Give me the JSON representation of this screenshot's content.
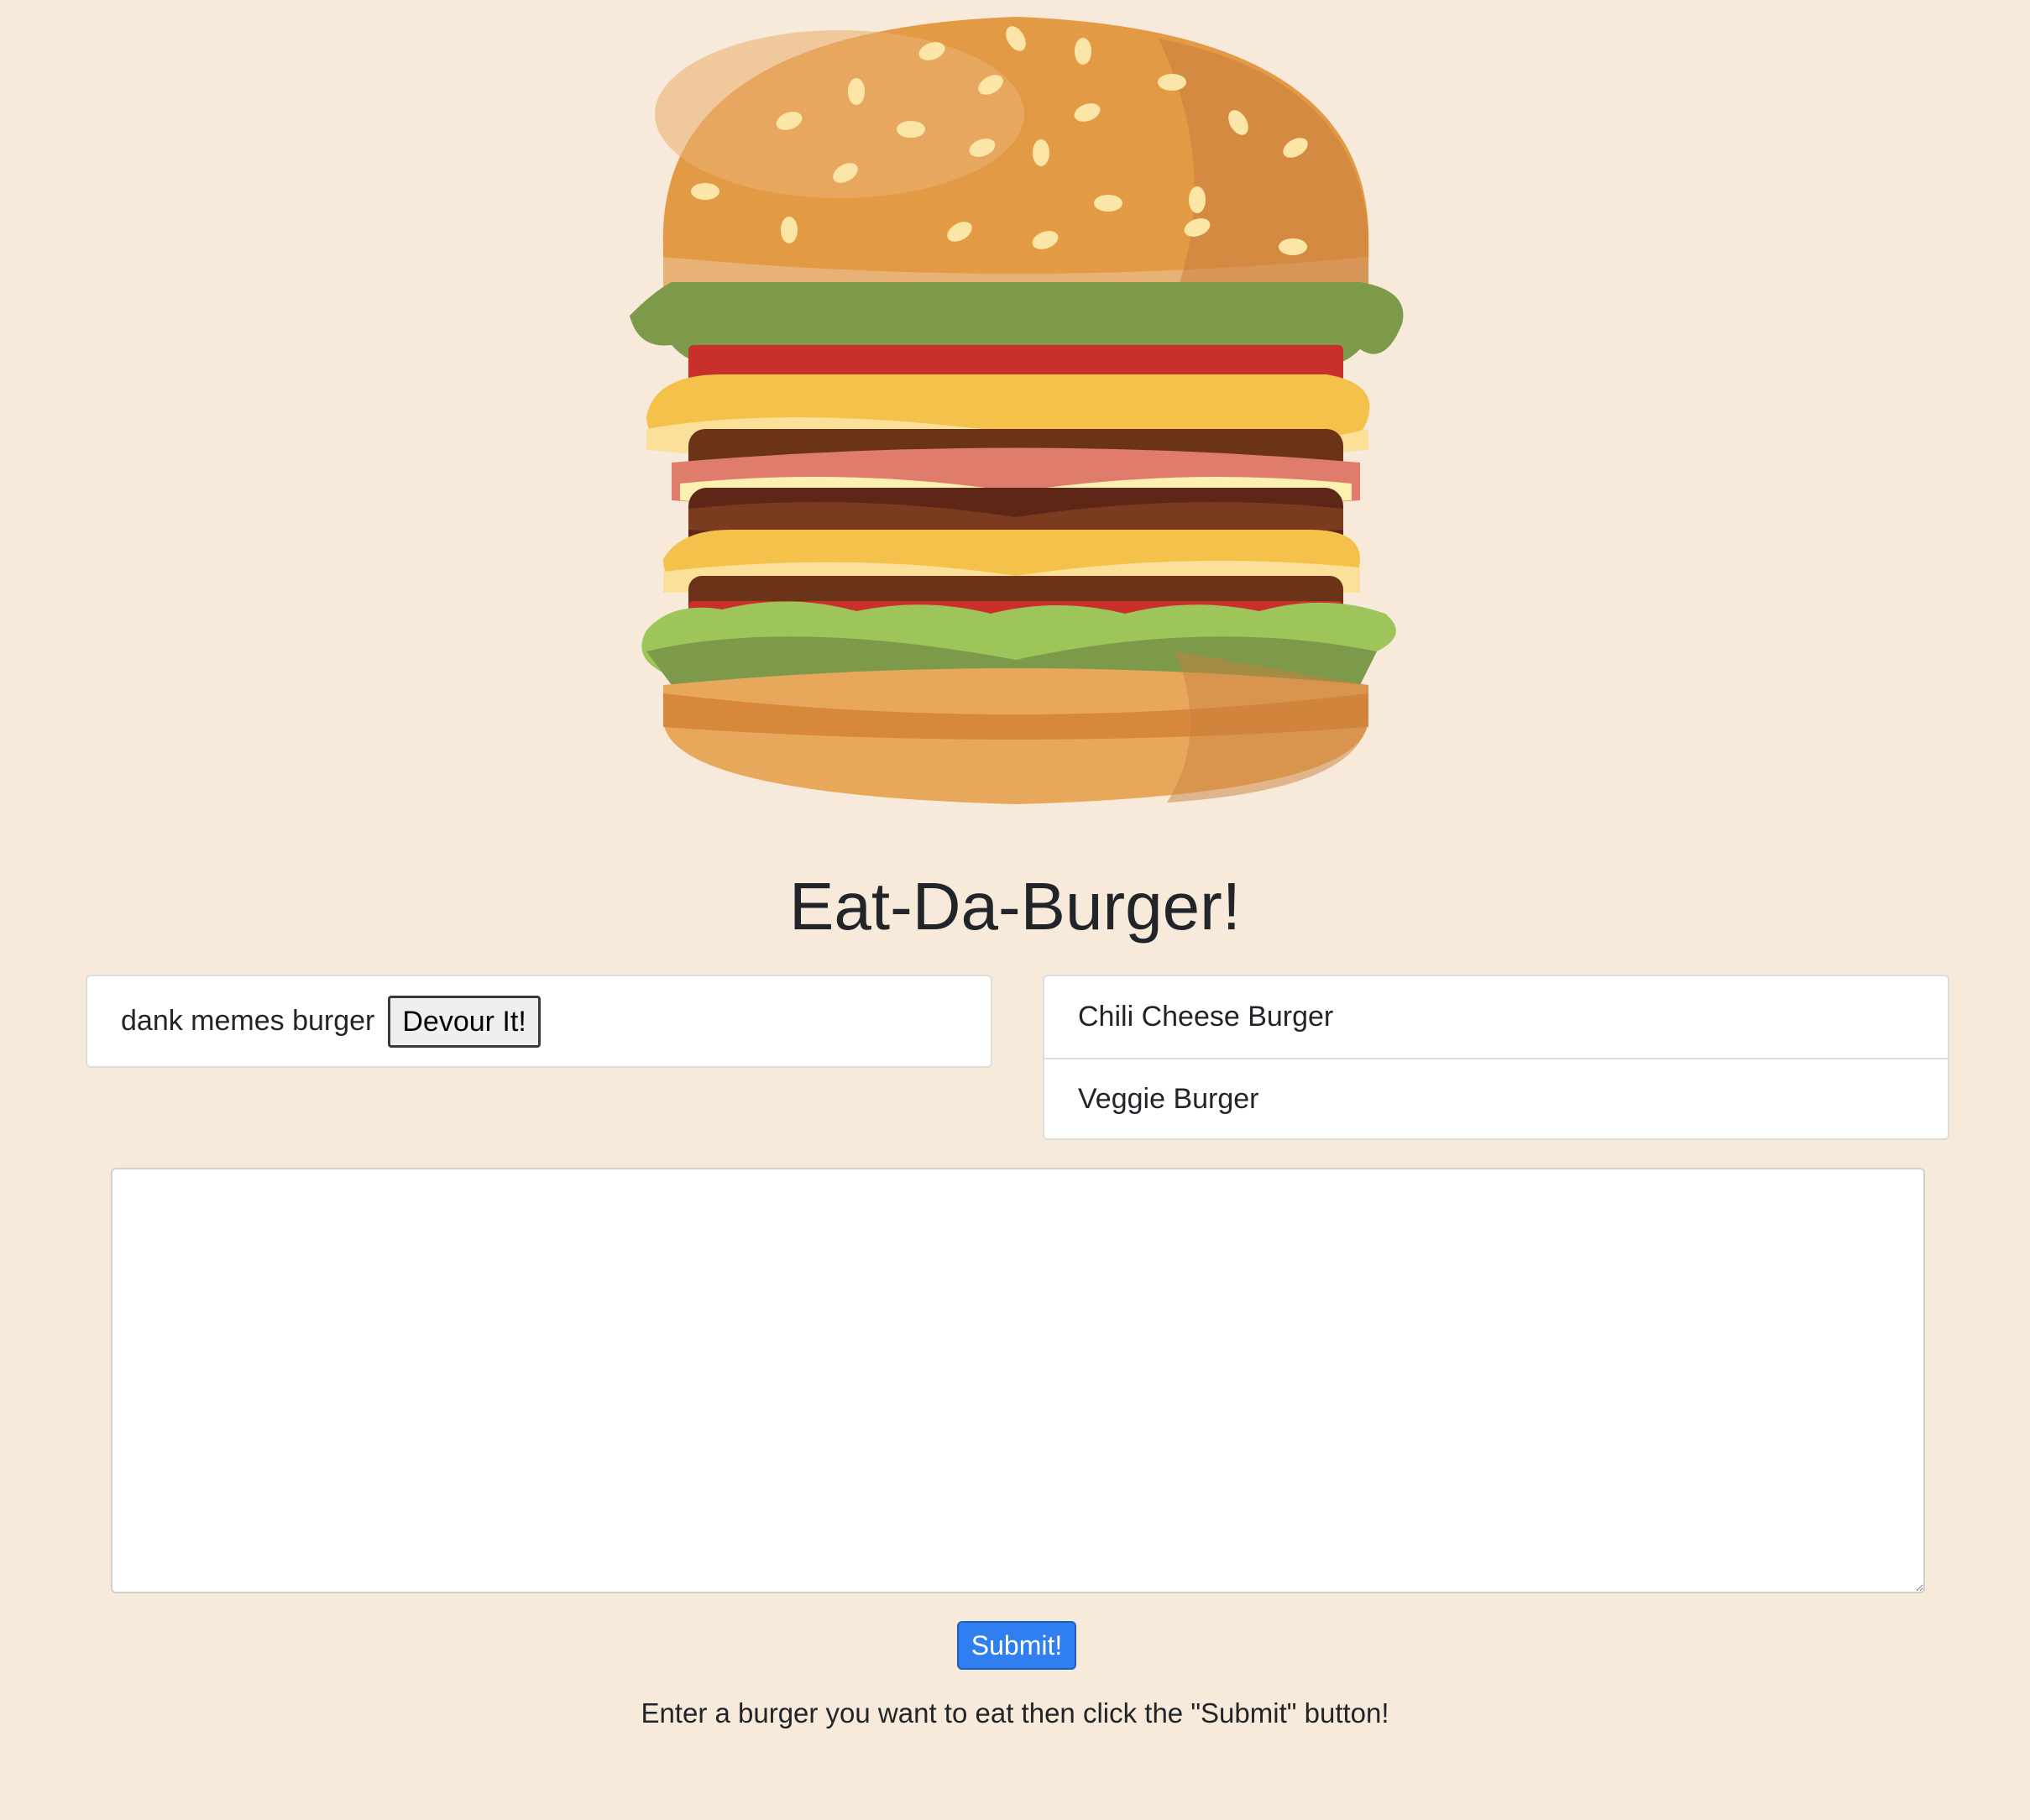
{
  "header": {
    "logo_icon": "burger-icon",
    "title": "Eat-Da-Burger!"
  },
  "uneaten": {
    "items": [
      {
        "name": "dank memes burger",
        "button_label": "Devour It!"
      }
    ]
  },
  "devoured": {
    "items": [
      {
        "name": "Chili Cheese Burger"
      },
      {
        "name": "Veggie Burger"
      }
    ]
  },
  "form": {
    "textarea_value": "",
    "submit_label": "Submit!",
    "instructions": "Enter a burger you want to eat then click the \"Submit\" button!"
  },
  "colors": {
    "background": "#f7eadb",
    "submit_button": "#2f7ff0"
  }
}
